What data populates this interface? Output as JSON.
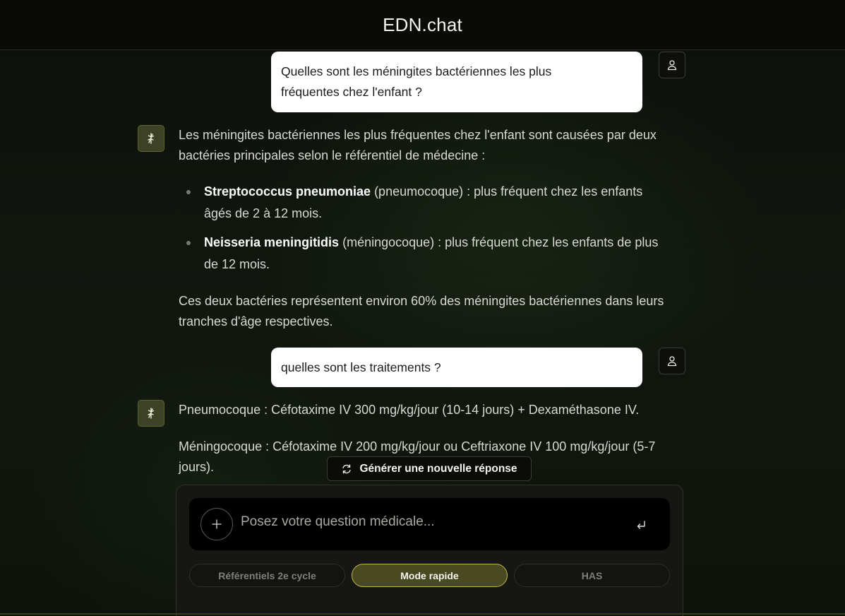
{
  "app": {
    "title": "EDN.chat"
  },
  "conversation": {
    "msg1_user_line1": "Quelles sont les méningites bactériennes les plus",
    "msg1_user_line2": "fréquentes chez l'enfant ?",
    "msg1_bot_intro": "Les méningites bactériennes les plus fréquentes chez l'enfant sont causées par deux bactéries principales selon le référentiel de médecine :",
    "msg1_bot_items": [
      {
        "bold": "Streptococcus pneumoniae",
        "text": " (pneumocoque) : plus fréquent chez les enfants âgés de 2 à 12 mois."
      },
      {
        "bold": "Neisseria meningitidis",
        "text": " (méningocoque) : plus fréquent chez les enfants de plus de 12 mois."
      }
    ],
    "msg1_bot_outro": "Ces deux bactéries représentent environ 60% des méningites bactériennes dans leurs tranches d'âge respectives.",
    "msg2_user": "quelles sont les traitements ?",
    "msg2_bot_p1": "Pneumocoque : Céfotaxime IV 300 mg/kg/jour (10-14 jours) + Dexaméthasone IV.",
    "msg2_bot_p2": "Méningocoque : Céfotaxime IV 200 mg/kg/jour ou Ceftriaxone IV 100 mg/kg/jour (5-7 jours)."
  },
  "actions": {
    "regenerate_label": "Générer une nouvelle réponse"
  },
  "composer": {
    "placeholder": "Posez votre question médicale...",
    "value": ""
  },
  "modes": [
    {
      "label": "Référentiels 2e cycle",
      "active": false
    },
    {
      "label": "Mode rapide",
      "active": true
    },
    {
      "label": "HAS",
      "active": false
    }
  ],
  "colors": {
    "accent": "#c2b54a",
    "accent_bg": "#4a4a22",
    "bot_icon_bg": "#3c4223",
    "background": "#0d110c"
  },
  "icons": {
    "user": "user-icon",
    "bot": "caduceus-icon",
    "refresh": "refresh-icon",
    "plus": "plus-icon",
    "send": "enter-icon"
  }
}
